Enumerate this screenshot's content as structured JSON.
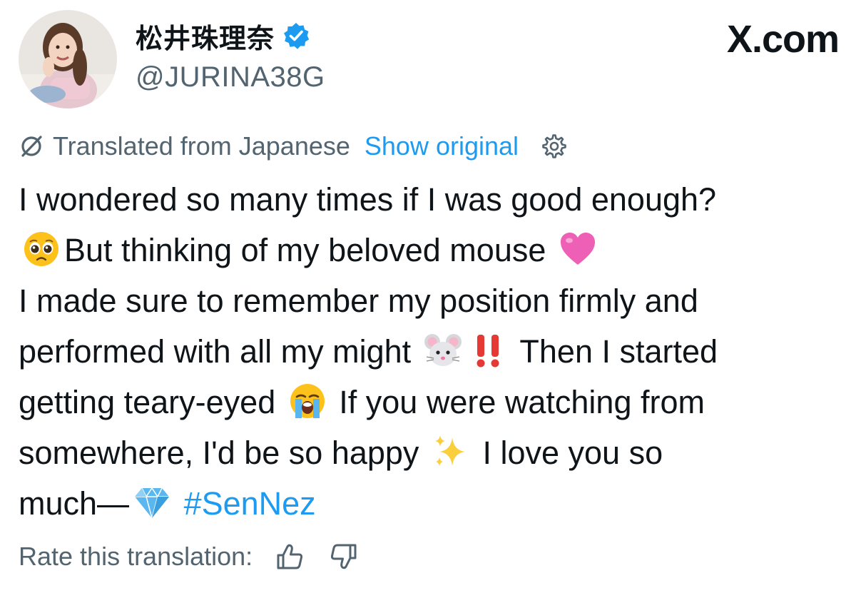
{
  "header": {
    "display_name": "松井珠理奈",
    "handle": "@JURINA38G",
    "site_logo": "X.com",
    "verified_icon": "verified-badge-icon",
    "verified_color": "#1d9bf0"
  },
  "translation": {
    "label": "Translated from Japanese",
    "show_original": "Show original",
    "icon": "translate-icon",
    "settings_icon": "gear-icon"
  },
  "tweet": {
    "segments": {
      "l1": "I wondered so many times if I was good enough?",
      "l2": "But thinking of my beloved mouse",
      "l3": "I made sure to remember my position firmly and",
      "l4a": "performed with all my might",
      "l4b": "Then I started",
      "l5a": "getting teary-eyed",
      "l5b": "If you were watching from",
      "l6a": "somewhere, I'd be so happy",
      "l6b": "I love you so",
      "l7a": "much—",
      "hashtag": "#SenNez"
    },
    "emojis": [
      "pleading-face-emoji",
      "pink-heart-emoji",
      "mouse-face-emoji",
      "double-exclamation-emoji",
      "loudly-crying-face-emoji",
      "sparkles-emoji",
      "gem-stone-emoji"
    ],
    "link_color": "#1d9bf0",
    "text_color": "#0f1419"
  },
  "rating": {
    "label": "Rate this translation:",
    "thumbs_up_icon": "thumbs-up-icon",
    "thumbs_down_icon": "thumbs-down-icon"
  },
  "colors": {
    "secondary_text": "#536471",
    "accent": "#1d9bf0",
    "background": "#ffffff"
  }
}
